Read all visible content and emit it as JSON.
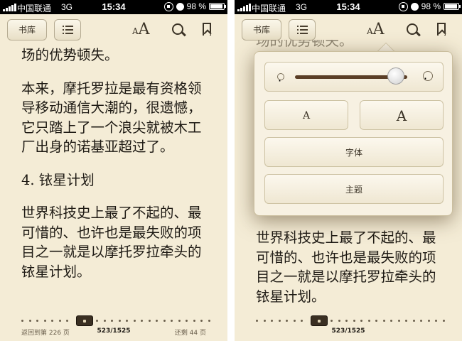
{
  "status_bar": {
    "carrier": "中国联通",
    "network": "3G",
    "time": "15:34",
    "battery": "98 %"
  },
  "toolbar": {
    "library_label": "书库",
    "font_size_small": "A",
    "font_size_large": "A"
  },
  "left_page": {
    "paragraphs": [
      "场的优势顿失。",
      "本来，摩托罗拉是最有资格领导移动通信大潮的，很遗憾，它只踏上了一个浪尖就被木工厂出身的诺基亚超过了。",
      "4. 铱星计划",
      "世界科技史上最了不起的、最可惜的、也许也是最失败的项目之一就是以摩托罗拉牵头的铱星计划。"
    ]
  },
  "right_page": {
    "partial_top_line": "场的优势顿失。",
    "paragraph": "世界科技史上最了不起的、最可惜的、也许也是最失败的项目之一就是以摩托罗拉牵头的铱星计划。"
  },
  "popover": {
    "font_small": "A",
    "font_large": "A",
    "fonts_label": "字体",
    "themes_label": "主题",
    "brightness_level": 0.9
  },
  "footer": {
    "back_link": "返回到第 226 页",
    "page_indicator": "523/1525",
    "remaining": "还剩 44 页"
  },
  "colors": {
    "paper": "#f4ecd6",
    "text": "#1e1a14",
    "slider_fill": "#5a3e26"
  }
}
